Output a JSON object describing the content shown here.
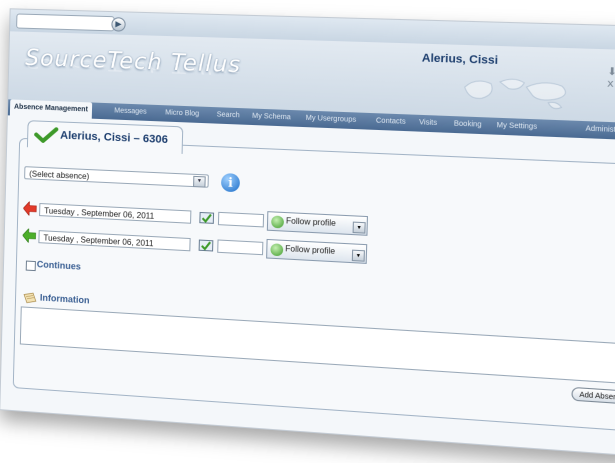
{
  "topbar": {
    "search_value": "",
    "user_name": "Alerius, Cissi",
    "window_controls": "⬇ ? x"
  },
  "brand": {
    "logo": "SourceTech Tellus",
    "logo_reflection": "SourceTech Tellus"
  },
  "nav": {
    "items": [
      "Absence Management",
      "Messages",
      "Micro Blog",
      "Search",
      "My Schema",
      "My Usergroups",
      "Contacts",
      "Visits",
      "Booking",
      "My Settings",
      "Administration"
    ]
  },
  "person_tab": {
    "title": "Alerius, Cissi – 6306"
  },
  "absence": {
    "select_value": "(Select absence)"
  },
  "start": {
    "date": "Tuesday  , September 06, 2011",
    "time": "",
    "profile": "Follow profile"
  },
  "end": {
    "date": "Tuesday  , September 06, 2011",
    "time": "",
    "profile": "Follow profile"
  },
  "continues": {
    "label": "Continues",
    "checked": false
  },
  "information": {
    "label": "Information",
    "value": ""
  },
  "actions": {
    "add_label": "Add Absence"
  },
  "colors": {
    "accent": "#1d3e6e",
    "nav_bg": "#5a7aa2",
    "link_label": "#3a5f93",
    "start_arrow": "#e23a2a",
    "end_arrow": "#4cae2a"
  }
}
